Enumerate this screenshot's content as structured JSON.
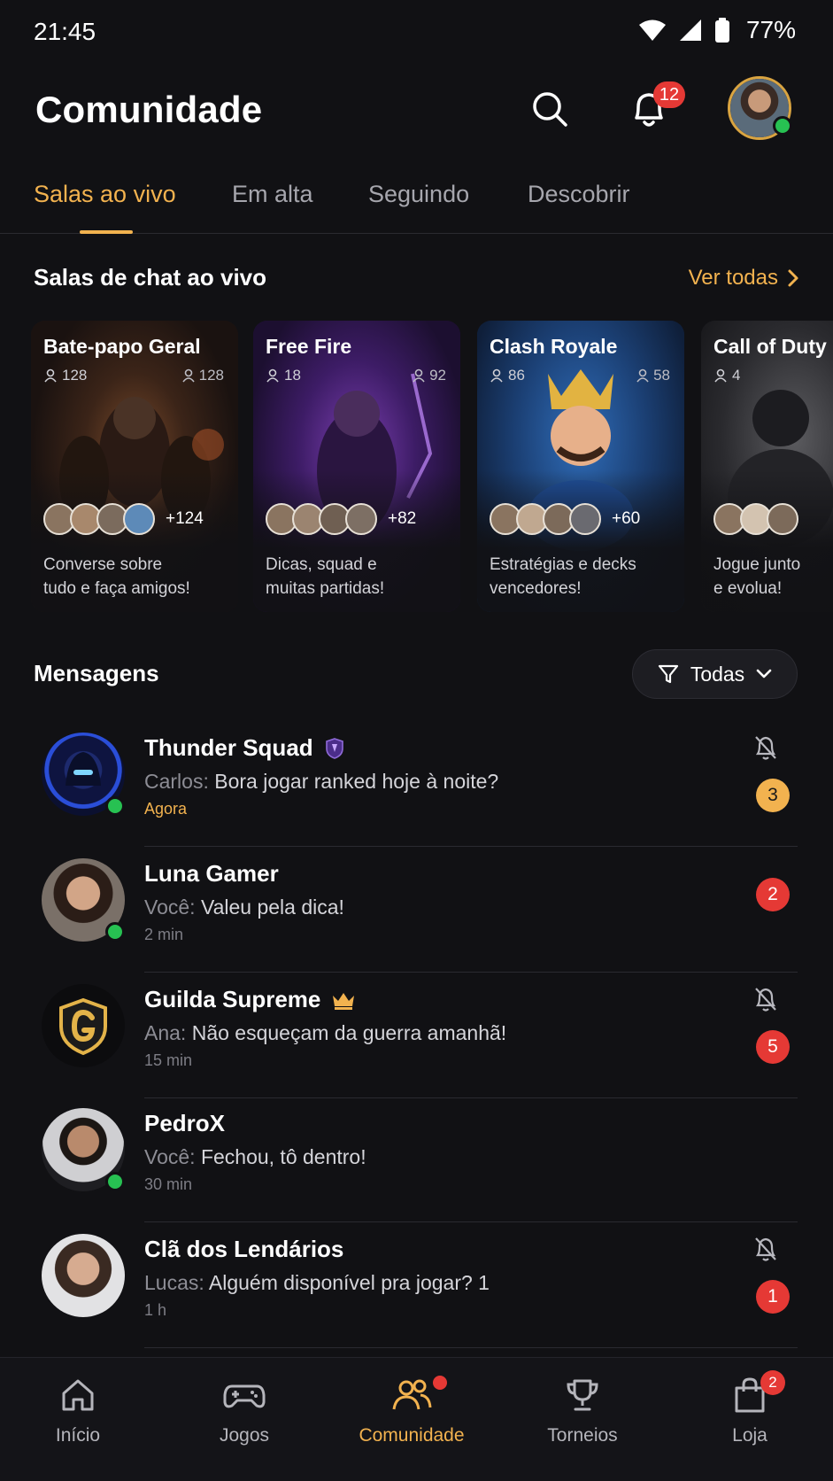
{
  "status_bar": {
    "time": "21:45",
    "battery": "77%"
  },
  "header": {
    "title": "Comunidade",
    "notification_count": "12"
  },
  "tabs": [
    {
      "label": "Salas ao vivo",
      "active": true
    },
    {
      "label": "Em alta",
      "active": false
    },
    {
      "label": "Seguindo",
      "active": false
    },
    {
      "label": "Descobrir",
      "active": false
    }
  ],
  "live_rooms": {
    "heading": "Salas de chat ao vivo",
    "see_all": "Ver todas",
    "rooms": [
      {
        "title": "Bate-papo Geral",
        "members": "128",
        "online": "128",
        "more": "+124",
        "description_line1": "Converse sobre",
        "description_line2": "tudo e faça amigos!"
      },
      {
        "title": "Free Fire",
        "members": "18",
        "online": "92",
        "more": "+82",
        "description_line1": "Dicas, squad e",
        "description_line2": "muitas partidas!"
      },
      {
        "title": "Clash Royale",
        "members": "86",
        "online": "58",
        "more": "+60",
        "description_line1": "Estratégias e decks",
        "description_line2": "vencedores!"
      },
      {
        "title": "Call of Duty",
        "members": "4",
        "online": "",
        "more": "",
        "description_line1": "Jogue junto",
        "description_line2": "e evolua!"
      }
    ]
  },
  "messages": {
    "heading": "Mensagens",
    "filter": "Todas",
    "items": [
      {
        "name": "Thunder Squad",
        "sender": "Carlos:",
        "text": "Bora jogar ranked hoje à noite?",
        "time": "Agora",
        "unread": "3",
        "muted": true,
        "online": true,
        "badge_icon": "shield-badge-icon"
      },
      {
        "name": "Luna Gamer",
        "sender": "Você:",
        "text": "Valeu pela dica!",
        "time": "2 min",
        "unread": "2",
        "muted": false,
        "online": true
      },
      {
        "name": "Guilda Supreme",
        "sender": "Ana:",
        "text": "Não esqueçam da guerra amanhã!",
        "time": "15 min",
        "unread": "5",
        "muted": true,
        "online": false,
        "badge_icon": "crown-icon"
      },
      {
        "name": "PedroX",
        "sender": "Você:",
        "text": "Fechou, tô dentro!",
        "time": "30 min",
        "unread": "",
        "muted": false,
        "online": true
      },
      {
        "name": "Clã dos Lendários",
        "sender": "Lucas:",
        "text": "Alguém disponível pra jogar? 1",
        "time": "1 h",
        "unread": "1",
        "muted": true,
        "online": false
      }
    ]
  },
  "bottom_nav": [
    {
      "label": "Início",
      "icon": "home-icon"
    },
    {
      "label": "Jogos",
      "icon": "gamepad-icon"
    },
    {
      "label": "Comunidade",
      "icon": "people-icon",
      "active": true
    },
    {
      "label": "Torneios",
      "icon": "trophy-icon"
    },
    {
      "label": "Loja",
      "icon": "shopping-bag-icon",
      "badge": "2"
    }
  ],
  "colors": {
    "accent": "#f2b24f",
    "badge_red": "#e53935",
    "online_green": "#27c152",
    "background": "#111114"
  }
}
